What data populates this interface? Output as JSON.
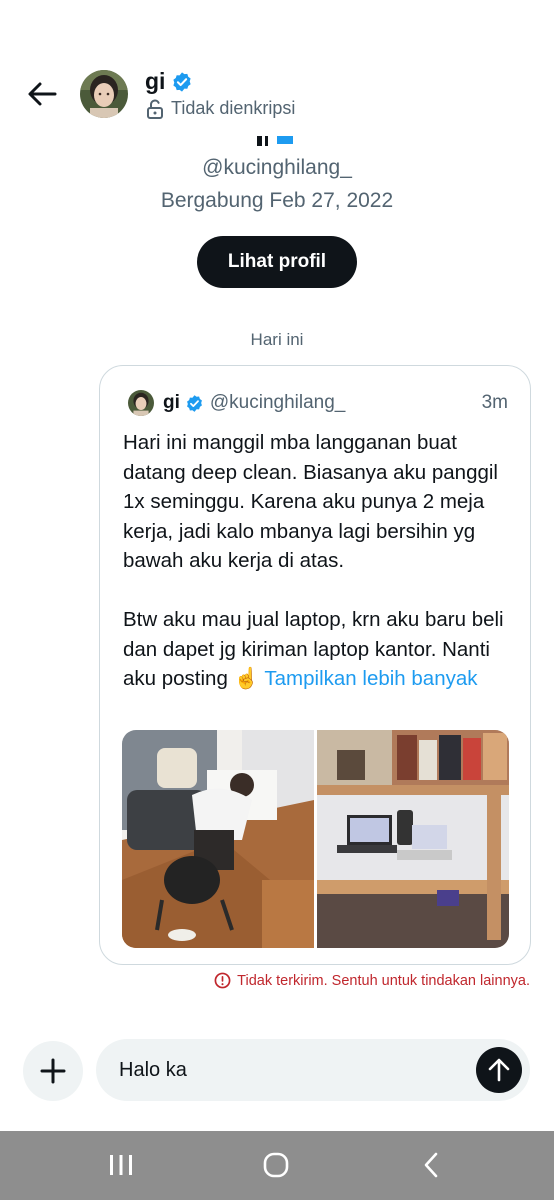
{
  "header": {
    "name": "gi",
    "encryption_status": "Tidak dienkripsi"
  },
  "profile": {
    "handle": "@kucinghilang_",
    "joined": "Bergabung Feb 27, 2022",
    "view_profile_label": "Lihat profil"
  },
  "conversation": {
    "day_separator": "Hari ini",
    "shared_tweet": {
      "author_name": "gi",
      "author_handle": "@kucinghilang_",
      "time": "3m",
      "paragraph_1": "Hari ini manggil mba langganan buat datang deep clean. Biasanya aku panggil 1x seminggu. Karena aku punya 2 meja kerja, jadi kalo mbanya lagi bersihin yg bawah aku kerja di atas.",
      "paragraph_2": "Btw aku mau jual laptop, krn aku baru beli dan dapet jg kiriman laptop kantor. Nanti aku posting ☝️",
      "show_more": "Tampilkan lebih banyak",
      "media": [
        "photo-person-cleaning-desk",
        "photo-loft-desk-with-laptops"
      ]
    },
    "send_error": "Tidak terkirim. Sentuh untuk tindakan lainnya."
  },
  "composer": {
    "value": "Halo ka"
  },
  "colors": {
    "verified_blue": "#1d9bf0",
    "link_blue": "#1d9bf0",
    "error_red": "#c0272d",
    "primary_text": "#0f1419",
    "secondary_text": "#536471",
    "nav_bar": "#8e8e8e"
  },
  "icons": {
    "back": "arrow-left-icon",
    "verified": "verified-badge-icon",
    "lock": "unlock-icon",
    "error": "error-circle-icon",
    "plus": "plus-icon",
    "send": "arrow-up-icon",
    "nav_recent": "recent-apps-icon",
    "nav_home": "home-icon",
    "nav_back": "nav-back-icon"
  }
}
